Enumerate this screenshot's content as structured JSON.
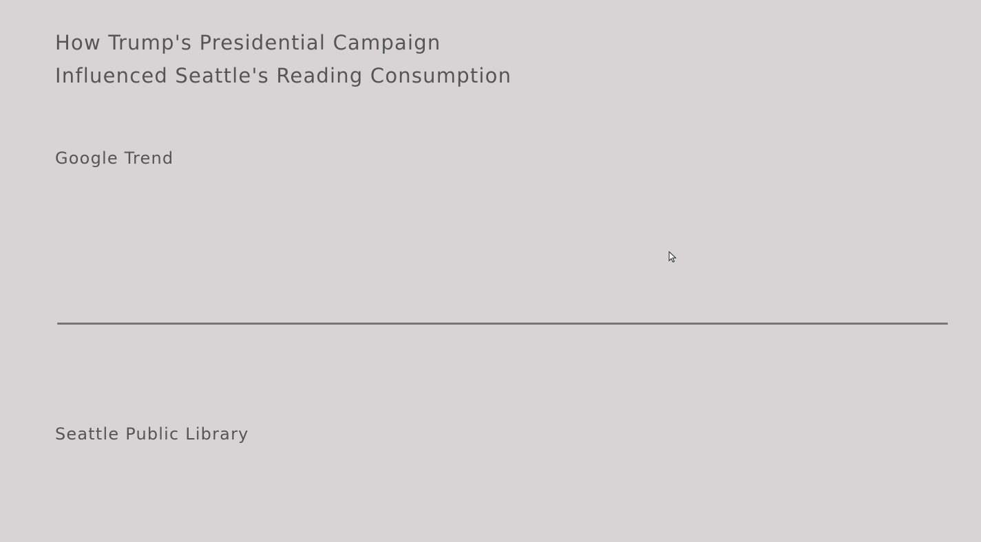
{
  "page": {
    "title_lines": [
      "How Trump's Presidential Campaign",
      "Influenced Seattle's Reading Consumption"
    ]
  },
  "sections": {
    "google_trend_label": "Google Trend",
    "library_label": "Seattle Public Library"
  },
  "cursor": {
    "icon": "pointer-arrow-icon"
  },
  "colors": {
    "background": "#d8d4d5",
    "text": "#555555",
    "divider": "#767676"
  }
}
